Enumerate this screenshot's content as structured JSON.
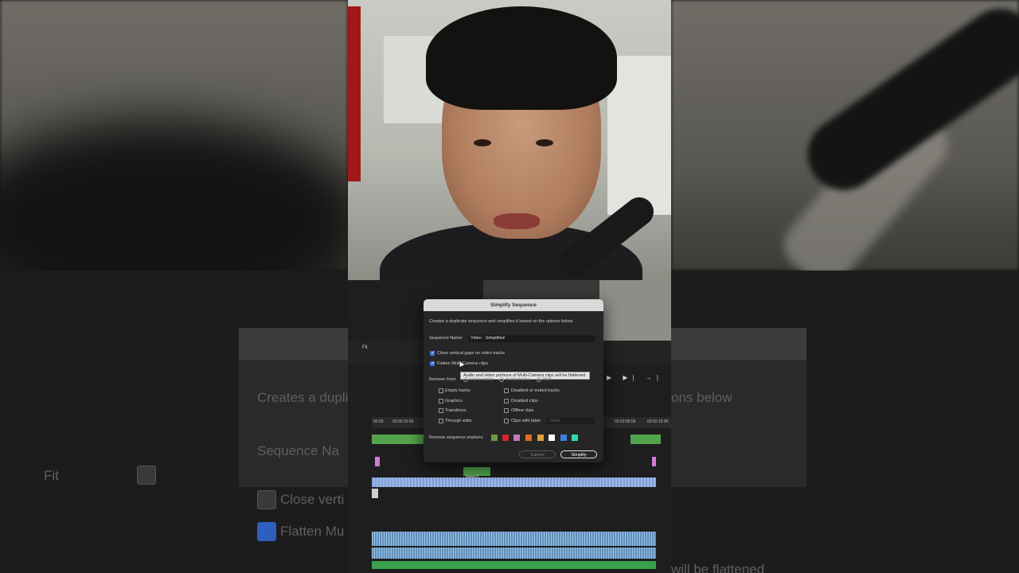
{
  "dialog": {
    "title": "Simplify Sequence",
    "description": "Creates a duplicate sequence and simplifies it based on the options below.",
    "sequence_name_label": "Sequence Name:",
    "sequence_name_value": "Video - Simplified",
    "option_close_gaps": "Close vertical gaps on video tracks",
    "option_flatten": "Flatten Multi-Camera clips",
    "tooltip": "Audio and video portions of Multi-Camera clips will be flattened.",
    "remove_from_label": "Remove from:",
    "remove_from_options": [
      "Video tracks",
      "Audio tracks",
      "Both"
    ],
    "remove_items_left": [
      "Empty tracks",
      "Graphics",
      "Transitions",
      "Through edits"
    ],
    "remove_items_right": [
      "Disabled or muted tracks",
      "Disabled clips",
      "Offline clips",
      "Clips with label"
    ],
    "label_select": "Violet",
    "remove_markers_label": "Remove sequence markers:",
    "marker_colors": [
      "#6a9a3e",
      "#d8252f",
      "#c57ab8",
      "#e56a28",
      "#e0a23a",
      "#ffffff",
      "#3d7fe0",
      "#2fd8b5"
    ],
    "cancel_label": "Cancel",
    "simplify_label": "Simplify"
  },
  "timeline": {
    "fit_label": "Fit",
    "timecodes": [
      "00:00",
      "00:00:15:00",
      "00:02:00:00",
      "00:02:15:00"
    ],
    "nested_clip_label": "Nested S"
  },
  "background": {
    "ghost_text_left": [
      "Creates a duplic",
      "Sequence Na",
      "Fit",
      "Close verti",
      "Flatten Mu"
    ],
    "ghost_text_right": [
      "ons below",
      "will be flattened"
    ]
  }
}
